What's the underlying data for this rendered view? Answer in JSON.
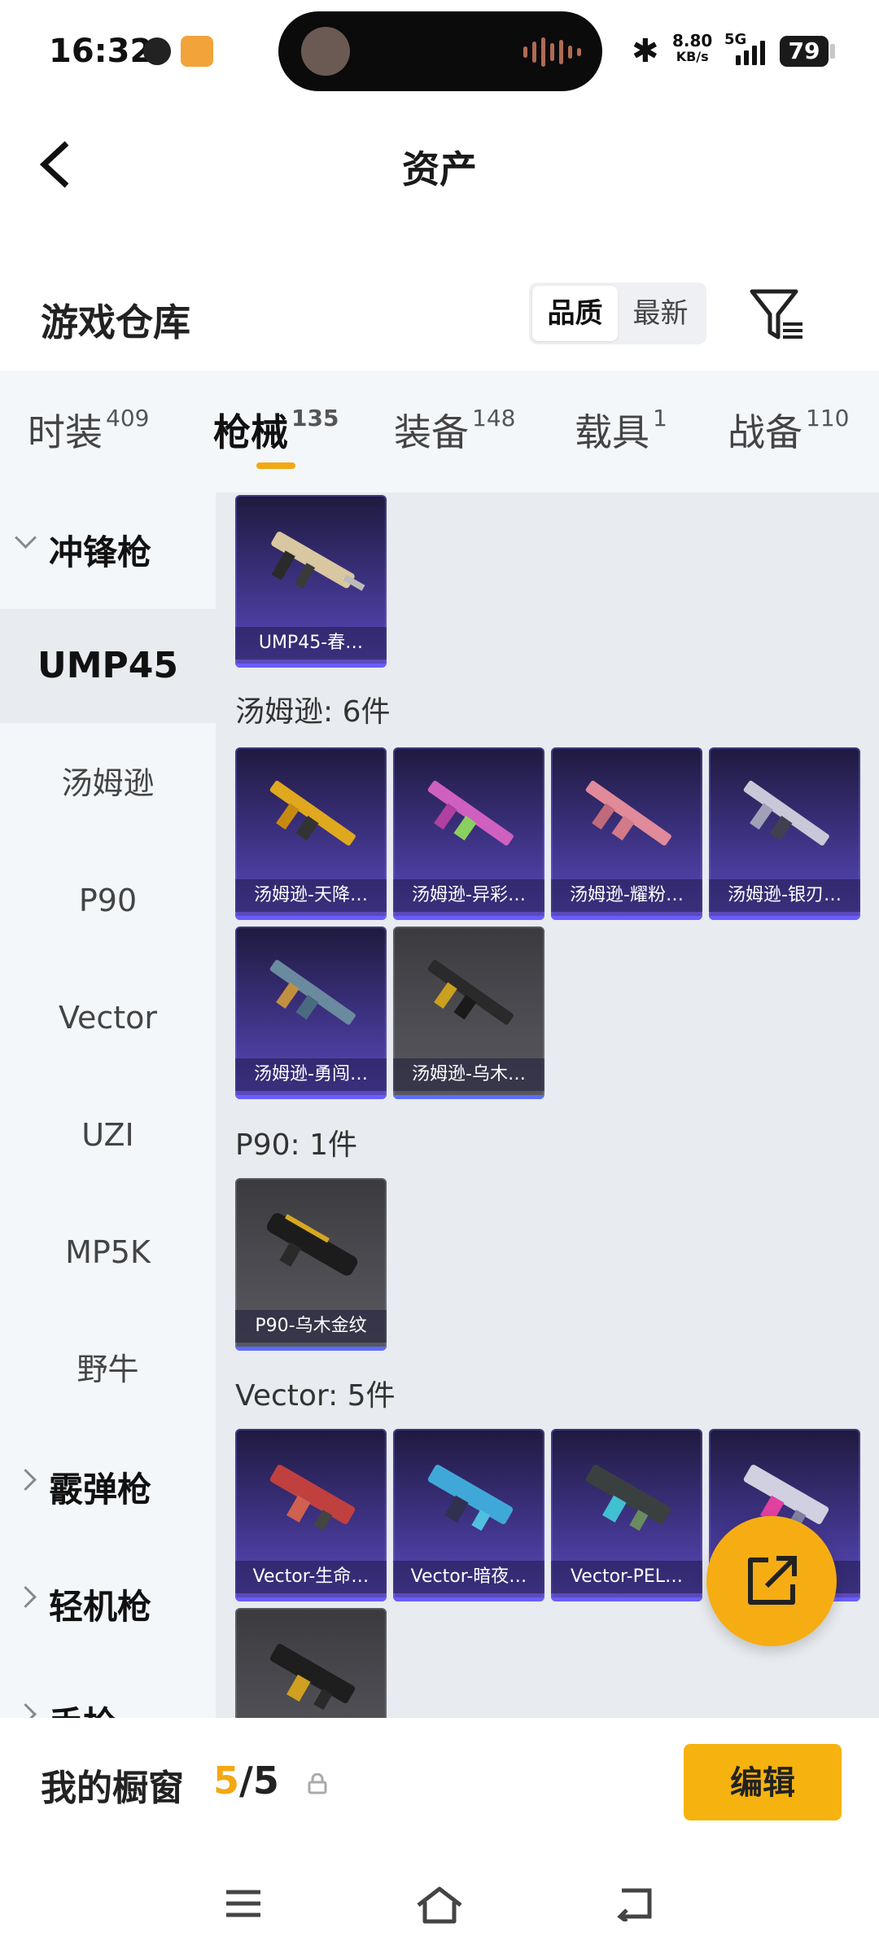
{
  "status_bar": {
    "time": "16:32",
    "net_speed_value": "8.80",
    "net_speed_unit": "KB/s",
    "network": "5G",
    "battery": "79"
  },
  "header": {
    "title": "资产"
  },
  "section": {
    "title": "游戏仓库",
    "sort_options": [
      "品质",
      "最新"
    ],
    "sort_selected": "品质"
  },
  "tabs": [
    {
      "label": "时装",
      "count": "409"
    },
    {
      "label": "枪械",
      "count": "135"
    },
    {
      "label": "装备",
      "count": "148"
    },
    {
      "label": "载具",
      "count": "1"
    },
    {
      "label": "战备",
      "count": "110"
    }
  ],
  "active_tab": "枪械",
  "sidebar": {
    "categories": [
      {
        "label": "冲锋枪",
        "expanded": true
      },
      {
        "label": "霰弹枪",
        "expanded": false
      },
      {
        "label": "轻机枪",
        "expanded": false
      },
      {
        "label": "手枪",
        "expanded": false
      }
    ],
    "subcategories": [
      "UMP45",
      "汤姆逊",
      "P90",
      "Vector",
      "UZI",
      "MP5K",
      "野牛"
    ],
    "selected_sub": "UMP45"
  },
  "groups": [
    {
      "label": "",
      "items": [
        {
          "name": "UMP45-春…",
          "tier": "purple"
        }
      ]
    },
    {
      "label": "汤姆逊: 6件",
      "items": [
        {
          "name": "汤姆逊-天降…",
          "tier": "purple"
        },
        {
          "name": "汤姆逊-异彩…",
          "tier": "purple"
        },
        {
          "name": "汤姆逊-耀粉…",
          "tier": "purple"
        },
        {
          "name": "汤姆逊-银刃…",
          "tier": "purple"
        },
        {
          "name": "汤姆逊-勇闯…",
          "tier": "purple"
        },
        {
          "name": "汤姆逊-乌木…",
          "tier": "grey"
        }
      ]
    },
    {
      "label": "P90: 1件",
      "items": [
        {
          "name": "P90-乌木金纹",
          "tier": "grey"
        }
      ]
    },
    {
      "label": "Vector: 5件",
      "items": [
        {
          "name": "Vector-生命…",
          "tier": "purple"
        },
        {
          "name": "Vector-暗夜…",
          "tier": "purple"
        },
        {
          "name": "Vector-PEL…",
          "tier": "purple"
        },
        {
          "name": "",
          "tier": "purple"
        },
        {
          "name": "",
          "tier": "grey"
        }
      ]
    }
  ],
  "bottom": {
    "showcase_label": "我的橱窗",
    "showcase_current": "5",
    "showcase_total": "/5",
    "edit_label": "编辑"
  },
  "colors": {
    "accent": "#f3a813",
    "purple_tier": "#4a3aa0",
    "grey_tier": "#4e4e54"
  }
}
